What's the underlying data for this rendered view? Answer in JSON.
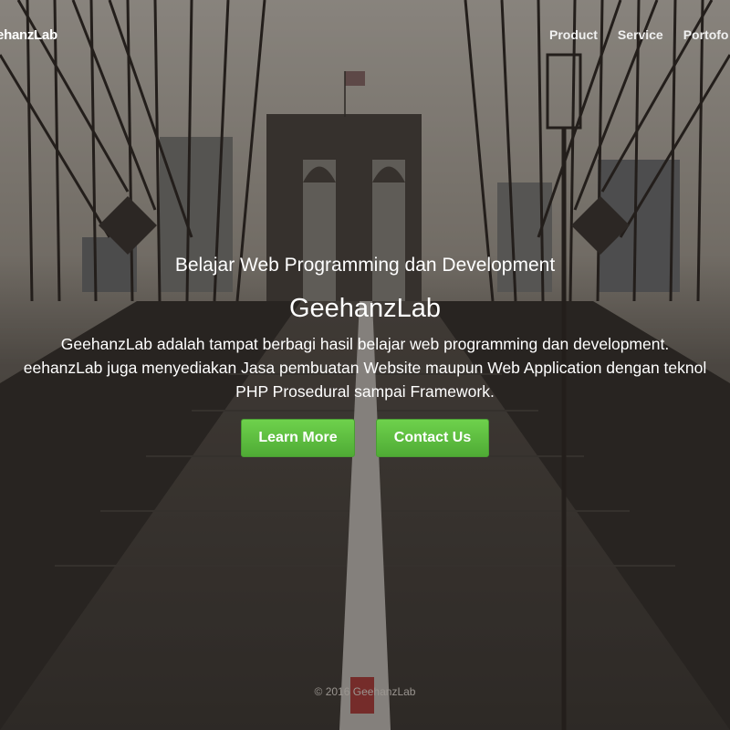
{
  "navbar": {
    "brand": "eehanzLab",
    "links": [
      "Product",
      "Service",
      "Portofo"
    ]
  },
  "hero": {
    "subtitle": "Belajar Web Programming dan Development",
    "title": "GeehanzLab",
    "description": [
      "GeehanzLab adalah tampat berbagi hasil belajar web programming dan development.",
      "eehanzLab juga menyediakan Jasa pembuatan Website maupun Web Application dengan teknol",
      "PHP Prosedural sampai Framework."
    ],
    "buttons": {
      "learn_more": "Learn More",
      "contact_us": "Contact Us"
    }
  },
  "footer": {
    "copyright": "© 2016 GeehanzLab"
  },
  "colors": {
    "button_green": "#5cbd3f",
    "overlay": "#2e2c2a"
  }
}
